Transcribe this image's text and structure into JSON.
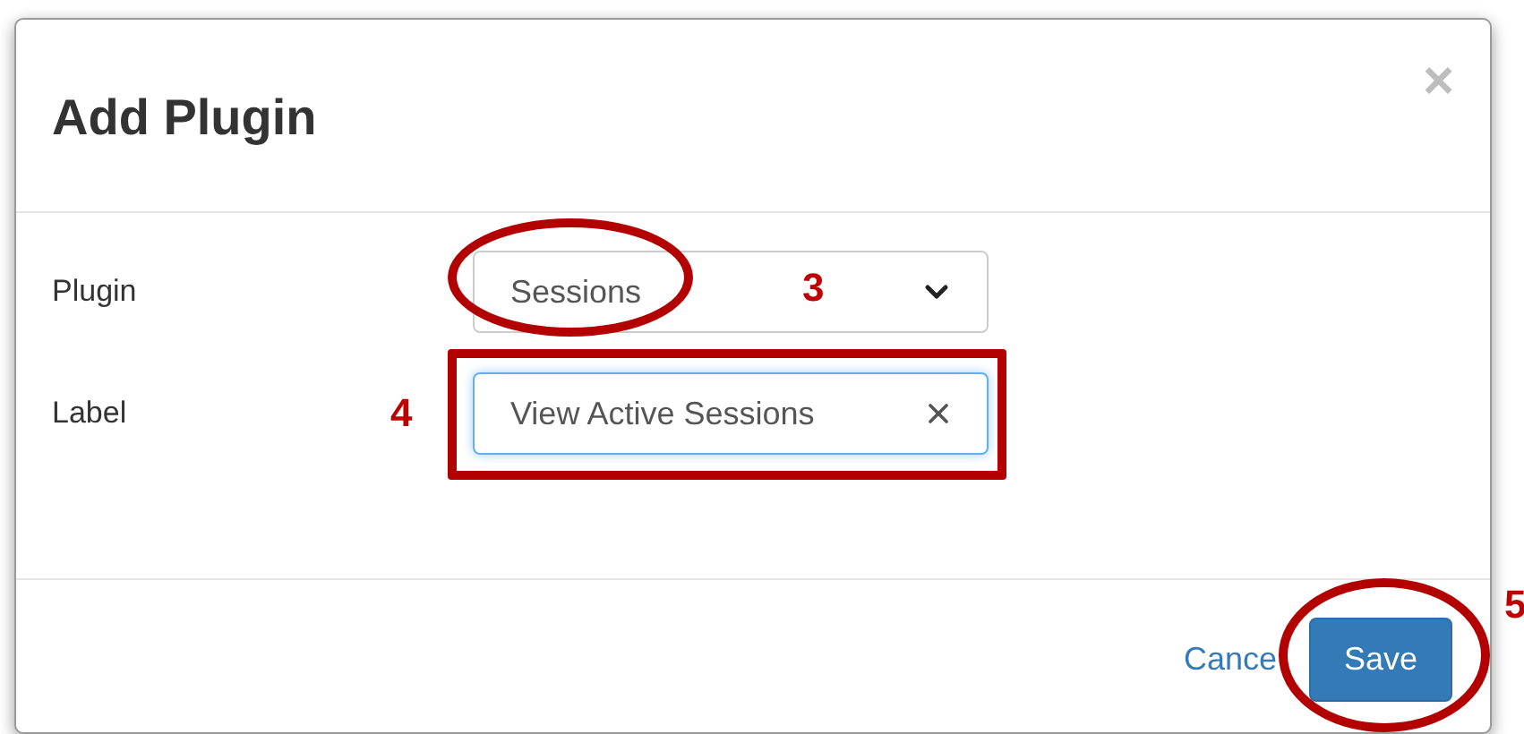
{
  "dialog": {
    "title": "Add Plugin",
    "close": "×"
  },
  "fields": [
    {
      "kind": "select",
      "label": "Plugin",
      "value": "Sessions"
    },
    {
      "kind": "text",
      "label": "Label",
      "value": "View Active Sessions"
    }
  ],
  "footer": {
    "cancel": "Cance",
    "save": "Save"
  },
  "annotations": [
    {
      "kind": "ellipse",
      "number": "3"
    },
    {
      "kind": "rectangle",
      "number": "4"
    },
    {
      "kind": "ellipse",
      "number": "5"
    }
  ]
}
